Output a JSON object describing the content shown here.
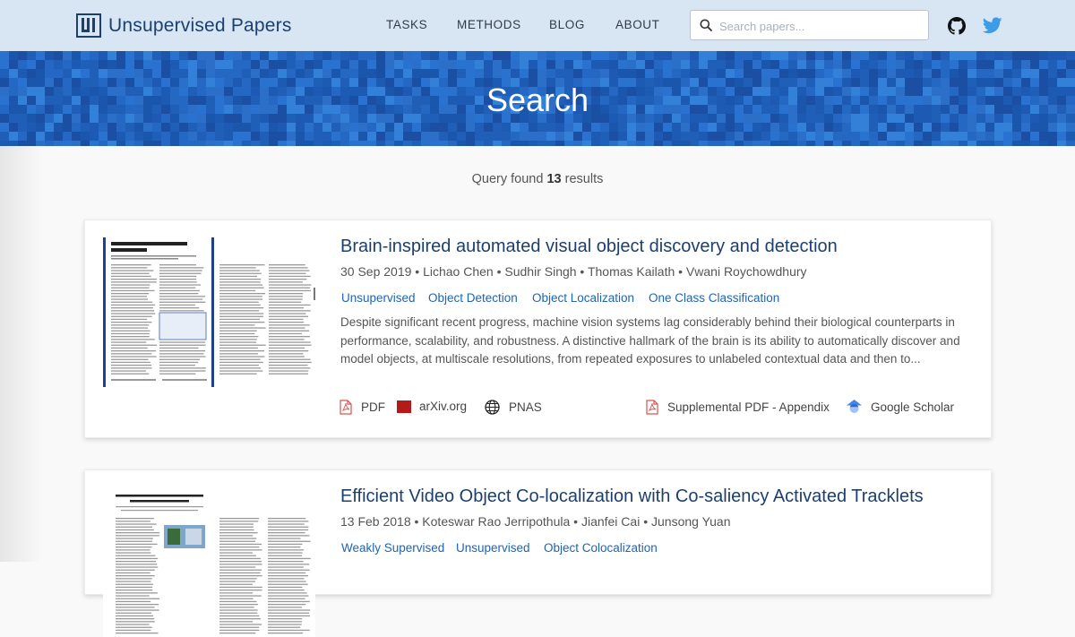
{
  "header": {
    "logo_text": "Unsupervised Papers",
    "nav": [
      "TASKS",
      "METHODS",
      "BLOG",
      "ABOUT"
    ],
    "search_placeholder": "Search papers...",
    "icons": [
      "github-icon",
      "twitter-icon"
    ]
  },
  "banner": {
    "title": "Search"
  },
  "results": {
    "prefix": "Query  found ",
    "count": "13",
    "suffix": " results"
  },
  "papers": [
    {
      "title": "Brain-inspired automated visual object discovery and detection",
      "meta": "30 Sep 2019 • Lichao Chen • Sudhir Singh • Thomas Kailath • Vwani Roychowdhury",
      "tags": [
        "Unsupervised",
        "Object Detection",
        "Object Localization",
        "One Class Classification"
      ],
      "abstract": "Despite significant recent progress, machine vision systems lag considerably behind their biological counterparts in performance, scalability, and robustness. A distinctive hallmark of the brain is its ability to automatically discover and model objects, at multiscale resolutions, from repeated exposures to unlabeled contextual data and then to...",
      "links": [
        "PDF",
        "arXiv.org",
        "PNAS",
        "Supplemental PDF - Appendix",
        "Google Scholar"
      ]
    },
    {
      "title": "Efficient Video Object Co-localization with Co-saliency Activated Tracklets",
      "meta": "13 Feb 2018 • Koteswar Rao Jerripothula • Jianfei Cai • Junsong Yuan",
      "tags": [
        "Weakly Supervised",
        "Unsupervised",
        "Object Colocalization"
      ]
    }
  ],
  "colors": {
    "header_bg": "#d8e6f3",
    "banner_bg": "#1f5fb8",
    "title": "#1c3f6e",
    "tag": "#1e64b4"
  }
}
